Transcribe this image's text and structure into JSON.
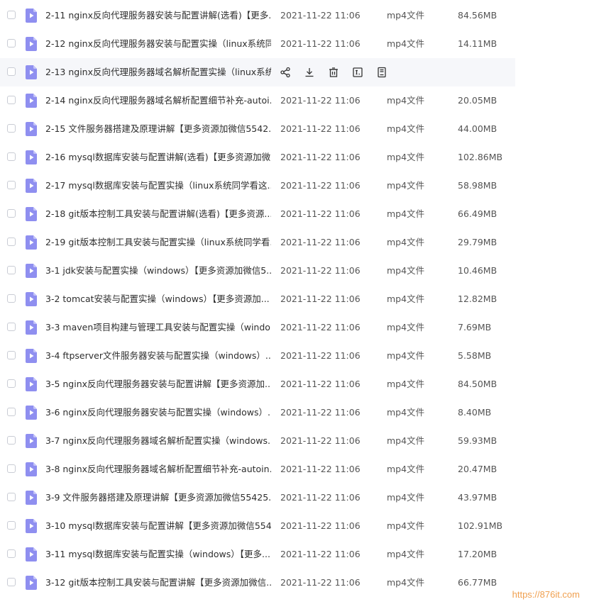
{
  "colors": {
    "file_icon": "#8f8ff0",
    "row_hover": "#f6f7fa",
    "action_icon": "#333333",
    "watermark": "#f0a050"
  },
  "files": [
    {
      "name": "2-11 nginx反向代理服务器安装与配置讲解(选看)【更多...",
      "date": "2021-11-22 11:06",
      "type": "mp4文件",
      "size": "84.56MB"
    },
    {
      "name": "2-12 nginx反向代理服务器安装与配置实操（linux系统同...",
      "date": "2021-11-22 11:06",
      "type": "mp4文件",
      "size": "14.11MB"
    },
    {
      "name": "2-13 nginx反向代理服务器域名解析配置实操（linux系统...",
      "date": "",
      "type": "",
      "size": "",
      "hovered": true
    },
    {
      "name": "2-14 nginx反向代理服务器域名解析配置细节补充-autoi...",
      "date": "2021-11-22 11:06",
      "type": "mp4文件",
      "size": "20.05MB"
    },
    {
      "name": "2-15 文件服务器搭建及原理讲解【更多资源加微信5542...",
      "date": "2021-11-22 11:06",
      "type": "mp4文件",
      "size": "44.00MB"
    },
    {
      "name": "2-16 mysql数据库安装与配置讲解(选看)【更多资源加微...",
      "date": "2021-11-22 11:06",
      "type": "mp4文件",
      "size": "102.86MB"
    },
    {
      "name": "2-17 mysql数据库安装与配置实操（linux系统同学看这...",
      "date": "2021-11-22 11:06",
      "type": "mp4文件",
      "size": "58.98MB"
    },
    {
      "name": "2-18 git版本控制工具安装与配置讲解(选看)【更多资源...",
      "date": "2021-11-22 11:06",
      "type": "mp4文件",
      "size": "66.49MB"
    },
    {
      "name": "2-19 git版本控制工具安装与配置实操（linux系统同学看...",
      "date": "2021-11-22 11:06",
      "type": "mp4文件",
      "size": "29.79MB"
    },
    {
      "name": "3-1 jdk安装与配置实操（windows）【更多资源加微信5...",
      "date": "2021-11-22 11:06",
      "type": "mp4文件",
      "size": "10.46MB"
    },
    {
      "name": "3-2 tomcat安装与配置实操（windows）【更多资源加...",
      "date": "2021-11-22 11:06",
      "type": "mp4文件",
      "size": "12.82MB"
    },
    {
      "name": "3-3 maven项目构建与管理工具安装与配置实操（windo...",
      "date": "2021-11-22 11:06",
      "type": "mp4文件",
      "size": "7.69MB"
    },
    {
      "name": "3-4 ftpserver文件服务器安装与配置实操（windows）...",
      "date": "2021-11-22 11:06",
      "type": "mp4文件",
      "size": "5.58MB"
    },
    {
      "name": "3-5 nginx反向代理服务器安装与配置讲解【更多资源加...",
      "date": "2021-11-22 11:06",
      "type": "mp4文件",
      "size": "84.50MB"
    },
    {
      "name": "3-6 nginx反向代理服务器安装与配置实操（windows）...",
      "date": "2021-11-22 11:06",
      "type": "mp4文件",
      "size": "8.40MB"
    },
    {
      "name": "3-7 nginx反向代理服务器域名解析配置实操（windows...",
      "date": "2021-11-22 11:06",
      "type": "mp4文件",
      "size": "59.93MB"
    },
    {
      "name": "3-8 nginx反向代理服务器域名解析配置细节补充-autoin...",
      "date": "2021-11-22 11:06",
      "type": "mp4文件",
      "size": "20.47MB"
    },
    {
      "name": "3-9 文件服务器搭建及原理讲解【更多资源加微信55425...",
      "date": "2021-11-22 11:06",
      "type": "mp4文件",
      "size": "43.97MB"
    },
    {
      "name": "3-10 mysql数据库安装与配置讲解【更多资源加微信554...",
      "date": "2021-11-22 11:06",
      "type": "mp4文件",
      "size": "102.91MB"
    },
    {
      "name": "3-11 mysql数据库安装与配置实操（windows）【更多...",
      "date": "2021-11-22 11:06",
      "type": "mp4文件",
      "size": "17.20MB"
    },
    {
      "name": "3-12 git版本本控制工具安装与配置讲解【更多资源加微信...",
      "date": "2021-11-22 11:06",
      "type": "mp4文件",
      "size": "66.77MB"
    }
  ],
  "hover_actions": [
    {
      "icon": "share-icon"
    },
    {
      "icon": "download-icon"
    },
    {
      "icon": "delete-icon"
    },
    {
      "icon": "rename-icon"
    },
    {
      "icon": "more-icon"
    }
  ],
  "watermark": "https://876it.com"
}
